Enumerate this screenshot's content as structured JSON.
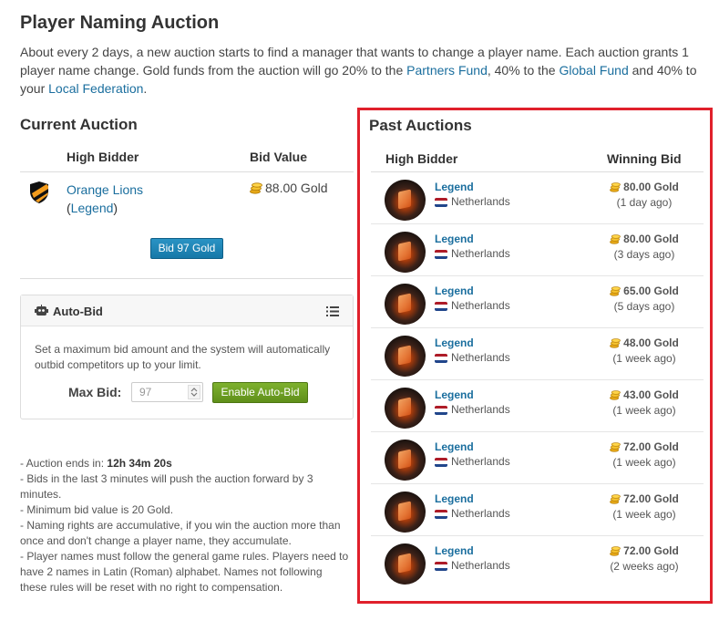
{
  "page": {
    "title": "Player Naming Auction",
    "intro_before_partners": "About every 2 days, a new auction starts to find a manager that wants to change a player name. Each auction grants 1 player name change. Gold funds from the auction will go 20% to the ",
    "partners_fund": "Partners Fund",
    "intro_mid": ", 40% to the ",
    "global_fund": "Global Fund",
    "intro_mid2": " and 40% to your ",
    "local_federation": "Local Federation",
    "intro_end": "."
  },
  "current": {
    "title": "Current Auction",
    "col_bidder": "High Bidder",
    "col_value": "Bid Value",
    "bidder_name": "Orange Lions",
    "bidder_paren_open": "(",
    "bidder_manager": "Legend",
    "bidder_paren_close": ")",
    "bid_value": "88.00 Gold",
    "bid_button": "Bid 97 Gold"
  },
  "autobid": {
    "title": "Auto-Bid",
    "description": "Set a maximum bid amount and the system will automatically outbid competitors up to your limit.",
    "max_bid_label": "Max Bid:",
    "max_bid_placeholder": "97",
    "enable_button": "Enable Auto-Bid"
  },
  "notes": {
    "ends_prefix": "- Auction ends in: ",
    "ends_value": "12h 34m 20s",
    "items": [
      "- Bids in the last 3 minutes will push the auction forward by 3 minutes.",
      "- Minimum bid value is 20 Gold.",
      "- Naming rights are accumulative, if you win the auction more than once and don't change a player name, they accumulate.",
      "- Player names must follow the general game rules. Players need to have 2 names in Latin (Roman) alphabet. Names not following these rules will be reset with no right to compensation."
    ]
  },
  "past": {
    "title": "Past Auctions",
    "col_bidder": "High Bidder",
    "col_bid": "Winning Bid",
    "rows": [
      {
        "name": "Legend",
        "country": "Netherlands",
        "gold": "80.00 Gold",
        "when": "(1 day ago)"
      },
      {
        "name": "Legend",
        "country": "Netherlands",
        "gold": "80.00 Gold",
        "when": "(3 days ago)"
      },
      {
        "name": "Legend",
        "country": "Netherlands",
        "gold": "65.00 Gold",
        "when": "(5 days ago)"
      },
      {
        "name": "Legend",
        "country": "Netherlands",
        "gold": "48.00 Gold",
        "when": "(1 week ago)"
      },
      {
        "name": "Legend",
        "country": "Netherlands",
        "gold": "43.00 Gold",
        "when": "(1 week ago)"
      },
      {
        "name": "Legend",
        "country": "Netherlands",
        "gold": "72.00 Gold",
        "when": "(1 week ago)"
      },
      {
        "name": "Legend",
        "country": "Netherlands",
        "gold": "72.00 Gold",
        "when": "(1 week ago)"
      },
      {
        "name": "Legend",
        "country": "Netherlands",
        "gold": "72.00 Gold",
        "when": "(2 weeks ago)"
      }
    ]
  },
  "colors": {
    "link": "#1a6e9e",
    "bid_button": "#1678a8",
    "enable_button": "#5f8f1a",
    "highlight_border": "#e0202b",
    "flag_nl": [
      "#ae1c28",
      "#ffffff",
      "#21468b"
    ]
  },
  "icons": {
    "shield": "shield-icon",
    "coin": "gold-coins-icon",
    "robot": "robot-icon",
    "list": "list-icon",
    "flag": "netherlands-flag-icon"
  }
}
